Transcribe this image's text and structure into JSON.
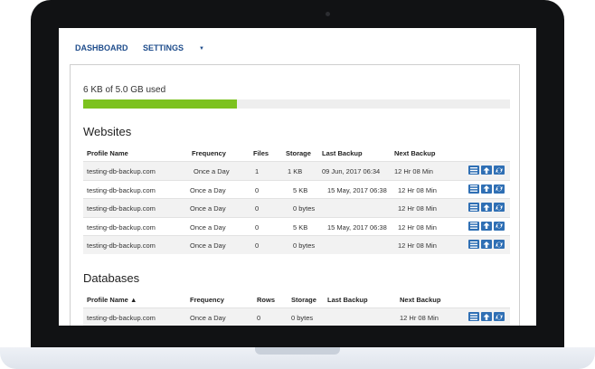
{
  "nav": {
    "dashboard": "DASHBOARD",
    "settings": "SETTINGS"
  },
  "usage": {
    "text": "6 KB of 5.0 GB used",
    "fraction": 0.36
  },
  "websites": {
    "title": "Websites",
    "headers": [
      "Profile Name",
      "Frequency",
      "Files",
      "Storage",
      "Last Backup",
      "Next Backup"
    ],
    "rows": [
      [
        "testing-db-backup.com",
        "Once a Day",
        "1",
        "1 KB",
        "09 Jun, 2017 06:34",
        "12 Hr 08 Min"
      ],
      [
        "testing-db-backup.com",
        "Once a Day",
        "0",
        "5 KB",
        "15 May, 2017 06:38",
        "12 Hr 08 Min"
      ],
      [
        "testing-db-backup.com",
        "Once a Day",
        "0",
        "0 bytes",
        "",
        "12 Hr 08 Min"
      ],
      [
        "testing-db-backup.com",
        "Once a Day",
        "0",
        "5 KB",
        "15 May, 2017 06:38",
        "12 Hr 08 Min"
      ],
      [
        "testing-db-backup.com",
        "Once a Day",
        "0",
        "0 bytes",
        "",
        "12 Hr 08 Min"
      ]
    ]
  },
  "databases": {
    "title": "Databases",
    "headers": [
      "Profile Name",
      "Frequency",
      "Rows",
      "Storage",
      "Last Backup",
      "Next Backup"
    ],
    "sort_indicator": "▲",
    "rows": [
      [
        "testing-db-backup.com",
        "Once a Day",
        "0",
        "0 bytes",
        "",
        "12 Hr 08 Min"
      ]
    ]
  },
  "icons": [
    "list-icon",
    "upload-icon",
    "refresh-icon"
  ],
  "colors": {
    "accent": "#2f6fb4",
    "progress": "#7cc21e",
    "nav": "#1f4d8c"
  }
}
